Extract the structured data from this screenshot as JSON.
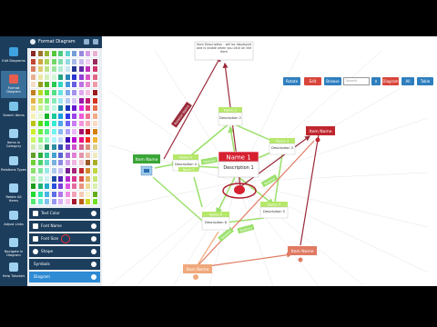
{
  "sidebar": {
    "items": [
      {
        "label": "Edit Diagrams",
        "icon": "edit-diagram-icon",
        "color": "#3fa3e0"
      },
      {
        "label": "Format Diagram",
        "icon": "format-brush-icon",
        "color": "#e85d4f"
      },
      {
        "label": "Search Items",
        "icon": "search-icon",
        "color": "#7cc3ea"
      },
      {
        "label": "Items in Category",
        "icon": "category-icon",
        "color": "#9fd2f0"
      },
      {
        "label": "Relations Types",
        "icon": "relations-icon",
        "color": "#9fd2f0"
      },
      {
        "label": "Relate All Items",
        "icon": "relate-icon",
        "color": "#9fd2f0"
      },
      {
        "label": "Adjust Links",
        "icon": "adjust-links-icon",
        "color": "#9fd2f0"
      },
      {
        "label": "Navigate in Diagram",
        "icon": "navigate-icon",
        "color": "#9fd2f0"
      },
      {
        "label": "Help Tutorials",
        "icon": "help-icon",
        "color": "#9fd2f0"
      }
    ]
  },
  "panel": {
    "title": "Format Diagram",
    "options": [
      {
        "label": "Text Color",
        "icon": "text-color-icon"
      },
      {
        "label": "Font Name",
        "icon": "font-name-icon"
      },
      {
        "label": "Font Size",
        "icon": "font-size-icon"
      },
      {
        "label": "Shape",
        "icon": "shape-icon"
      },
      {
        "label": "Symbols",
        "icon": "symbols-icon"
      },
      {
        "label": "Diagram",
        "icon": "diagram-icon"
      }
    ]
  },
  "toolbar": {
    "buttons": [
      {
        "label": "Rotate",
        "color": "#2f7fbf"
      },
      {
        "label": "Edit",
        "color": "#d9453b"
      },
      {
        "label": "Browse",
        "color": "#2f7fbf"
      },
      {
        "label": "Diagram",
        "color": "#d9453b"
      },
      {
        "label": "All",
        "color": "#2f7fbf"
      },
      {
        "label": "Table",
        "color": "#2f7fbf"
      }
    ],
    "search_placeholder": "Search"
  },
  "diagram": {
    "tooltip": "Item Description - will be displayed and is visible when you click on the Item",
    "nodes": [
      {
        "title": "Name 1",
        "desc": "Description\n1",
        "color": "#d62030"
      },
      {
        "title": "Name 2",
        "desc": "Description\n2",
        "color": "#b6e86a"
      },
      {
        "title": "Name 3",
        "desc": "Description\n3",
        "color": "#b6e86a"
      },
      {
        "title": "Name 4",
        "desc": "Description\n4",
        "color": "#b6e86a"
      },
      {
        "title": "Name 5",
        "desc": "Description\n5",
        "color": "#b6e86a"
      },
      {
        "title": "Name 6",
        "desc": "Description\n6",
        "color": "#b6e86a"
      },
      {
        "title": "Name 7",
        "desc": "Description\n7",
        "color": "#b6e86a"
      },
      {
        "title": "Item Name",
        "color": "#3aa537"
      },
      {
        "title": "Item Name",
        "color": "#c0262e"
      },
      {
        "title": "Item Name",
        "color": "#e07a62"
      },
      {
        "title": "Item Name",
        "color": "#f0a97c"
      }
    ],
    "link_labels": [
      "Relation Name",
      "Relation",
      "Relation",
      "Relation",
      "Relation"
    ]
  }
}
